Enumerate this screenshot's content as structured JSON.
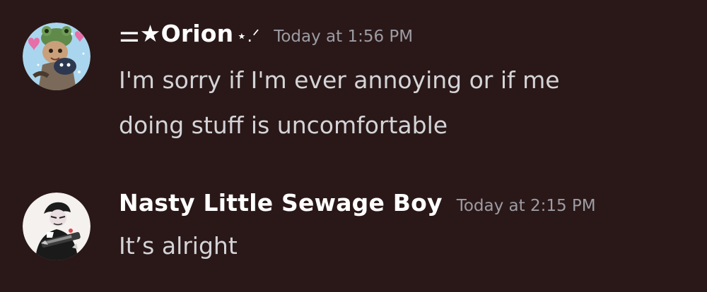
{
  "messages": [
    {
      "avatar": "frog-hat-character-avatar",
      "username": "⚌★Orion",
      "username_decoration": "⋆.ᐟ",
      "timestamp": "Today at 1:56 PM",
      "text": "I'm sorry if I'm ever annoying or if me\ndoing stuff is uncomfortable"
    },
    {
      "avatar": "agent-character-avatar",
      "username": "Nasty Little Sewage Boy",
      "timestamp": "Today at 2:15 PM",
      "text": "It’s alright"
    }
  ],
  "colors": {
    "background": "#2a1818",
    "username": "#ffffff",
    "timestamp": "#9d9ca4",
    "message_text": "#d4d4d8"
  }
}
